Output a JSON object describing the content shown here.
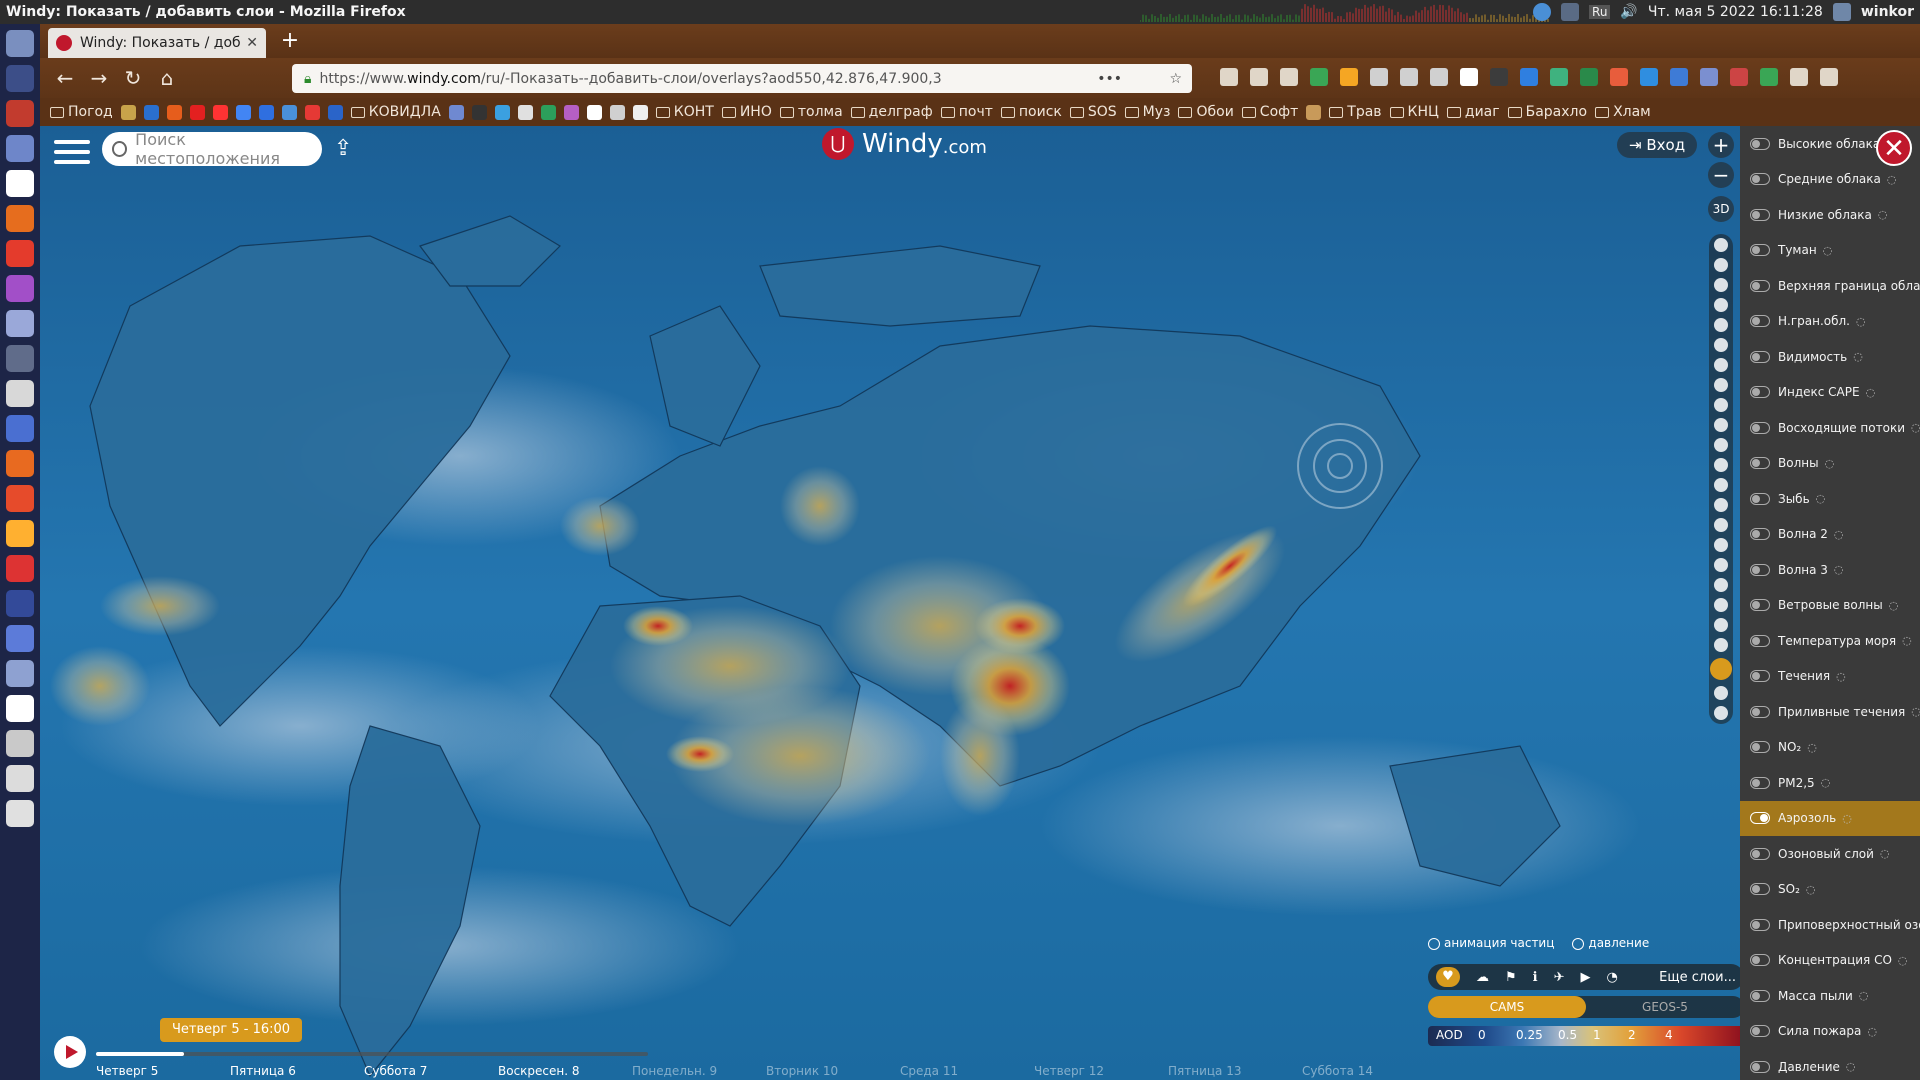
{
  "os": {
    "window_title": "Windy: Показать / добавить слои - Mozilla Firefox",
    "datetime": "Чт. мая  5 2022 16:11:28",
    "user": "winkor",
    "lang": "Ru"
  },
  "browser": {
    "tab_title": "Windy: Показать / доба",
    "url_prefix": "https://www.",
    "url_domain": "windy.com",
    "url_path": "/ru/-Показать--добавить-слои/overlays?aod550,42.876,47.900,3"
  },
  "bookmarks": [
    {
      "label": "Погод",
      "type": "folder"
    },
    {
      "label": "",
      "type": "icon",
      "color": "#c8a34a"
    },
    {
      "label": "",
      "type": "icon",
      "color": "#2a6fce"
    },
    {
      "label": "",
      "type": "icon",
      "color": "#e65d1c"
    },
    {
      "label": "",
      "type": "icon",
      "color": "#e32020"
    },
    {
      "label": "",
      "type": "icon",
      "color": "#ff3333"
    },
    {
      "label": "",
      "type": "icon",
      "color": "#4285f4"
    },
    {
      "label": "",
      "type": "icon",
      "color": "#2f6fe0"
    },
    {
      "label": "",
      "type": "icon",
      "color": "#4a90d9"
    },
    {
      "label": "",
      "type": "icon",
      "color": "#e53935"
    },
    {
      "label": "",
      "type": "icon",
      "color": "#2a64c9"
    },
    {
      "label": "КОВИДЛА",
      "type": "folder"
    },
    {
      "label": "",
      "type": "icon",
      "color": "#6f89d1"
    },
    {
      "label": "",
      "type": "icon",
      "color": "#333333"
    },
    {
      "label": "",
      "type": "icon",
      "color": "#3ba0e0"
    },
    {
      "label": "",
      "type": "icon",
      "color": "#e0e0e0"
    },
    {
      "label": "",
      "type": "icon",
      "color": "#2c9f5b"
    },
    {
      "label": "",
      "type": "icon",
      "color": "#b55fc4"
    },
    {
      "label": "",
      "type": "icon",
      "color": "#ffffff"
    },
    {
      "label": "",
      "type": "icon",
      "color": "#d0d0d0"
    },
    {
      "label": "",
      "type": "icon",
      "color": "#eeeeee"
    },
    {
      "label": "КОНТ",
      "type": "folder"
    },
    {
      "label": "ИНО",
      "type": "folder"
    },
    {
      "label": "толма",
      "type": "folder"
    },
    {
      "label": "делграф",
      "type": "folder"
    },
    {
      "label": "почт",
      "type": "folder"
    },
    {
      "label": "поиск",
      "type": "folder"
    },
    {
      "label": "SOS",
      "type": "folder"
    },
    {
      "label": "Муз",
      "type": "folder"
    },
    {
      "label": "Обои",
      "type": "folder"
    },
    {
      "label": "Софт",
      "type": "folder"
    },
    {
      "label": "",
      "type": "icon",
      "color": "#c89a5a"
    },
    {
      "label": "Трав",
      "type": "folder"
    },
    {
      "label": "КНЦ",
      "type": "folder"
    },
    {
      "label": "диаг",
      "type": "folder"
    },
    {
      "label": "Барахло",
      "type": "folder"
    },
    {
      "label": "Хлам",
      "type": "folder"
    }
  ],
  "windy": {
    "search_placeholder": "Поиск местоположения",
    "logo_text": "Windy",
    "logo_suffix": ".com",
    "login_label": "Вход",
    "three_d": "3D",
    "opt_particles": "анимация частиц",
    "opt_pressure": "давление",
    "more_layers": "Еще слои...",
    "sources": [
      "CAMS",
      "GEOS-5"
    ],
    "active_source": "CAMS",
    "scale_label": "AOD",
    "scale_ticks": [
      "0",
      "0.25",
      "0.5",
      "1",
      "2",
      "4"
    ],
    "time_bubble": "Четверг 5 - 16:00",
    "timeline_progress": 0.16,
    "days": [
      "Четверг 5",
      "Пятница 6",
      "Суббота 7",
      "Воскресен. 8",
      "Понедельн. 9",
      "Вторник 10",
      "Среда 11",
      "Четверг 12",
      "Пятница 13",
      "Суббота 14"
    ],
    "days_future_from": 4
  },
  "layers": [
    {
      "label": "Высокие облака",
      "active": false
    },
    {
      "label": "Средние облака",
      "active": false
    },
    {
      "label": "Низкие облака",
      "active": false
    },
    {
      "label": "Туман",
      "active": false
    },
    {
      "label": "Верхняя граница облаков",
      "active": false
    },
    {
      "label": "Н.гран.обл.",
      "active": false
    },
    {
      "label": "Видимость",
      "active": false
    },
    {
      "label": "Индекс CAPE",
      "active": false
    },
    {
      "label": "Восходящие потоки",
      "active": false
    },
    {
      "label": "Волны",
      "active": false
    },
    {
      "label": "Зыбь",
      "active": false
    },
    {
      "label": "Волна 2",
      "active": false
    },
    {
      "label": "Волна 3",
      "active": false
    },
    {
      "label": "Ветровые волны",
      "active": false
    },
    {
      "label": "Температура моря",
      "active": false
    },
    {
      "label": "Течения",
      "active": false
    },
    {
      "label": "Приливные течения",
      "active": false
    },
    {
      "label": "NO₂",
      "active": false
    },
    {
      "label": "PM2,5",
      "active": false
    },
    {
      "label": "Аэрозоль",
      "active": true
    },
    {
      "label": "Озоновый слой",
      "active": false
    },
    {
      "label": "SO₂",
      "active": false
    },
    {
      "label": "Приповерхностный озон",
      "active": false
    },
    {
      "label": "Концентрация CO",
      "active": false
    },
    {
      "label": "Масса пыли",
      "active": false
    },
    {
      "label": "Сила пожара",
      "active": false
    },
    {
      "label": "Давление",
      "active": false
    }
  ],
  "colors": {
    "accent": "#d89a1d",
    "windy_red": "#c0182c",
    "ocean": "#1d6fa6"
  }
}
